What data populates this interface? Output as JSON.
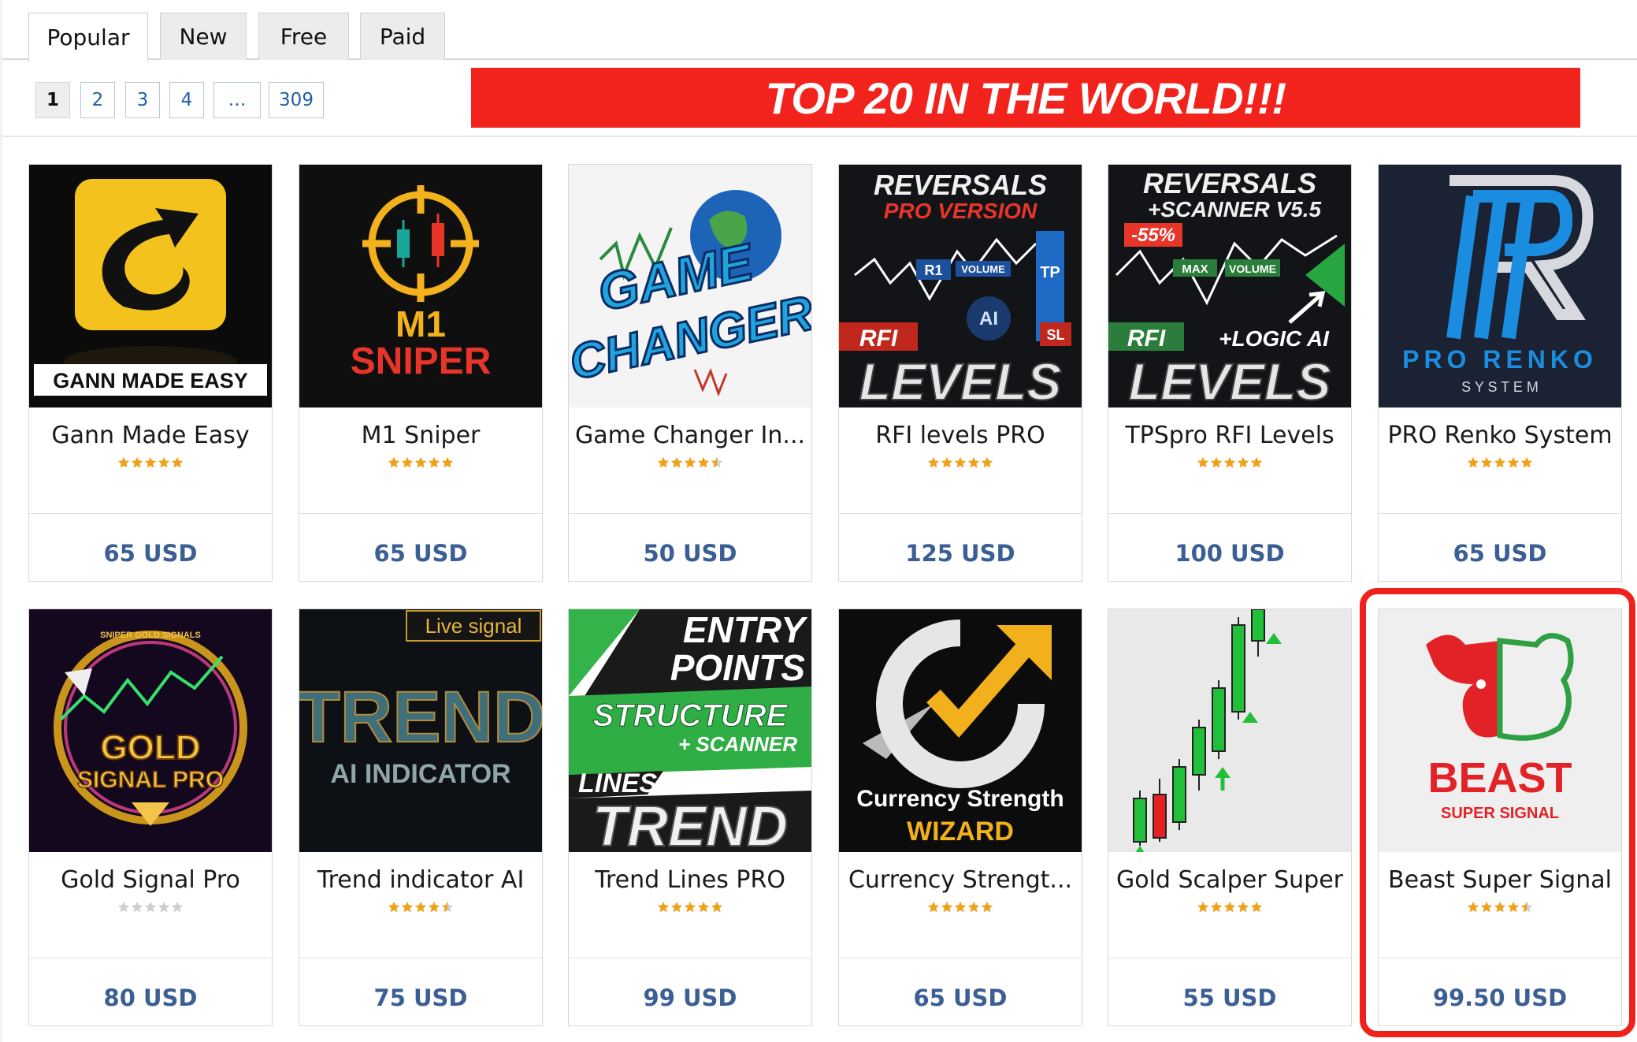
{
  "tabs": [
    {
      "label": "Popular",
      "active": true
    },
    {
      "label": "New",
      "active": false
    },
    {
      "label": "Free",
      "active": false
    },
    {
      "label": "Paid",
      "active": false
    }
  ],
  "pagination": [
    "1",
    "2",
    "3",
    "4",
    "…",
    "309"
  ],
  "pagination_current": "1",
  "banner": {
    "text": "TOP 20 IN THE WORLD!!!",
    "color": "#f2231c"
  },
  "colors": {
    "price": "#3b5f94",
    "star_filled": "#f0a11b",
    "star_empty": "#cfcfcf",
    "highlight": "#f0211a"
  },
  "products": [
    {
      "title": "Gann Made Easy",
      "rating": 5,
      "price": "65 USD",
      "thumb": {
        "texts": [
          "GANN MADE EASY"
        ],
        "icon": "gann-logo-icon"
      }
    },
    {
      "title": "M1 Sniper",
      "rating": 5,
      "price": "65 USD",
      "thumb": {
        "texts": [
          "M1",
          "SNIPER"
        ],
        "icon": "crosshair-icon"
      }
    },
    {
      "title": "Game Changer In...",
      "rating": 4.5,
      "price": "50 USD",
      "thumb": {
        "texts": [
          "GAME",
          "CHANGER"
        ],
        "icon": "globe-icon"
      }
    },
    {
      "title": "RFI levels PRO",
      "rating": 5,
      "price": "125 USD",
      "thumb": {
        "texts": [
          "REVERSALS",
          "PRO VERSION",
          "R1",
          "VOLUME",
          "TP",
          "AI",
          "SL",
          "RFI",
          "LEVELS"
        ],
        "icon": "chart-levels-icon"
      }
    },
    {
      "title": "TPSpro RFI Levels",
      "rating": 5,
      "price": "100 USD",
      "thumb": {
        "texts": [
          "REVERSALS",
          "+SCANNER V5.5",
          "-55%",
          "MAX",
          "VOLUME",
          "RFI",
          "+LOGIC AI",
          "LEVELS"
        ],
        "icon": "chart-levels-icon"
      }
    },
    {
      "title": "PRO Renko System",
      "rating": 5,
      "price": "65 USD",
      "thumb": {
        "texts": [
          "PRO RENKO",
          "S Y S T E M"
        ],
        "icon": "renko-logo-icon"
      }
    },
    {
      "title": "Gold Signal Pro",
      "rating": 0,
      "price": "80 USD",
      "thumb": {
        "texts": [
          "SNIPER GOLD SIGNALS",
          "GOLD",
          "SIGNAL PRO"
        ],
        "icon": "gold-ring-icon"
      }
    },
    {
      "title": "Trend indicator AI",
      "rating": 4.5,
      "price": "75 USD",
      "thumb": {
        "texts": [
          "Live signal",
          "TREND",
          "AI INDICATOR"
        ],
        "icon": "trend-text-icon"
      }
    },
    {
      "title": "Trend Lines PRO",
      "rating": 5,
      "price": "99 USD",
      "thumb": {
        "texts": [
          "ENTRY",
          "POINTS",
          "STRUCTURE",
          "+ SCANNER",
          "LINES",
          "TREND"
        ],
        "icon": "trend-lines-icon"
      }
    },
    {
      "title": "Currency Strengt...",
      "rating": 5,
      "price": "65 USD",
      "thumb": {
        "texts": [
          "Currency Strength",
          "WIZARD"
        ],
        "icon": "currency-wizard-icon"
      }
    },
    {
      "title": "Gold Scalper Super",
      "rating": 5,
      "price": "55 USD",
      "thumb": {
        "texts": [],
        "icon": "candlestick-icon"
      }
    },
    {
      "title": "Beast Super Signal",
      "rating": 4.5,
      "price": "99.50 USD",
      "thumb": {
        "texts": [
          "BEAST",
          "SUPER SIGNAL"
        ],
        "icon": "bull-bear-icon"
      }
    }
  ]
}
